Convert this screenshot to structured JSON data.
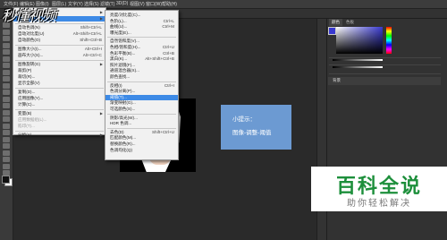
{
  "menubar": {
    "items": [
      "文件(F)",
      "编辑(E)",
      "图像(I)",
      "图层(L)",
      "文字(Y)",
      "选择(S)",
      "滤镜(T)",
      "3D(D)",
      "视图(V)",
      "窗口(W)",
      "帮助(H)"
    ]
  },
  "watermark": {
    "text": "秒懂视频"
  },
  "image_menu": {
    "items": [
      {
        "label": "模式(M)",
        "shortcut": "",
        "submenu": true
      },
      {
        "label": "调整(J)",
        "shortcut": "",
        "submenu": true,
        "highlight": true
      },
      {
        "label": "自动色调(N)",
        "shortcut": "Shift+Ctrl+L"
      },
      {
        "label": "自动对比度(U)",
        "shortcut": "Alt+Shift+Ctrl+L"
      },
      {
        "label": "自动颜色(O)",
        "shortcut": "Shift+Ctrl+B"
      },
      {
        "label": "图像大小(I)...",
        "shortcut": "Alt+Ctrl+I"
      },
      {
        "label": "画布大小(S)...",
        "shortcut": "Alt+Ctrl+C"
      },
      {
        "label": "图像旋转(G)",
        "shortcut": "",
        "submenu": true
      },
      {
        "label": "裁剪(P)",
        "shortcut": ""
      },
      {
        "label": "裁切(R)...",
        "shortcut": ""
      },
      {
        "label": "显示全部(V)",
        "shortcut": ""
      },
      {
        "label": "复制(D)...",
        "shortcut": ""
      },
      {
        "label": "应用图像(Y)...",
        "shortcut": ""
      },
      {
        "label": "计算(C)...",
        "shortcut": ""
      },
      {
        "label": "变量(B)",
        "shortcut": "",
        "submenu": true
      },
      {
        "label": "应用数据组(L)...",
        "shortcut": "",
        "disabled": true
      },
      {
        "label": "陷印(T)...",
        "shortcut": "",
        "disabled": true
      },
      {
        "label": "分析(A)",
        "shortcut": "",
        "submenu": true
      }
    ]
  },
  "adjust_menu": {
    "items": [
      {
        "label": "亮度/对比度(C)...",
        "shortcut": ""
      },
      {
        "label": "色阶(L)...",
        "shortcut": "Ctrl+L"
      },
      {
        "label": "曲线(U)...",
        "shortcut": "Ctrl+M"
      },
      {
        "label": "曝光度(E)...",
        "shortcut": ""
      },
      {
        "label": "自然饱和度(V)...",
        "shortcut": ""
      },
      {
        "label": "色相/饱和度(H)...",
        "shortcut": "Ctrl+U"
      },
      {
        "label": "色彩平衡(B)...",
        "shortcut": "Ctrl+B"
      },
      {
        "label": "黑白(K)...",
        "shortcut": "Alt+Shift+Ctrl+B"
      },
      {
        "label": "照片滤镜(F)...",
        "shortcut": ""
      },
      {
        "label": "通道混合器(X)...",
        "shortcut": ""
      },
      {
        "label": "颜色查找...",
        "shortcut": ""
      },
      {
        "label": "反相(I)",
        "shortcut": "Ctrl+I"
      },
      {
        "label": "色调分离(P)...",
        "shortcut": ""
      },
      {
        "label": "阈值(T)...",
        "shortcut": "",
        "highlight": true
      },
      {
        "label": "渐变映射(G)...",
        "shortcut": ""
      },
      {
        "label": "可选颜色(S)...",
        "shortcut": ""
      },
      {
        "label": "阴影/高光(W)...",
        "shortcut": ""
      },
      {
        "label": "HDR 色调...",
        "shortcut": ""
      },
      {
        "label": "去色(D)",
        "shortcut": "Shift+Ctrl+U"
      },
      {
        "label": "匹配颜色(M)...",
        "shortcut": ""
      },
      {
        "label": "替换颜色(R)...",
        "shortcut": ""
      },
      {
        "label": "色调均化(Q)",
        "shortcut": ""
      }
    ]
  },
  "tip": {
    "title": "小提示：",
    "body": "图像-调整-阈值"
  },
  "panels": {
    "tabs": [
      "颜色",
      "色板"
    ],
    "layer_label": "背景"
  },
  "brand": {
    "title": "百科全说",
    "subtitle": "助你轻松解决"
  },
  "colors": {
    "accent": "#3d8ae6",
    "tip_bg": "#6c9ad2",
    "brand_green": "#1d8f3b"
  }
}
